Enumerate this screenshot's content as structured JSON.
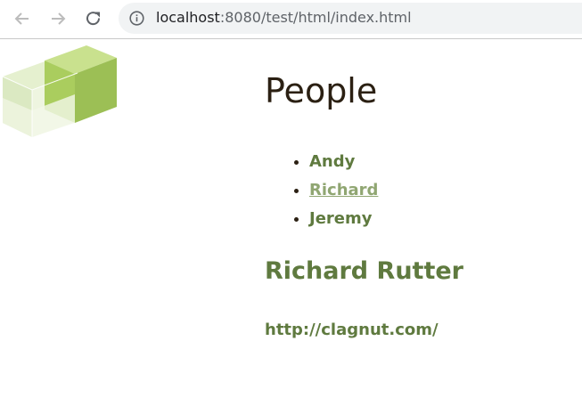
{
  "browser": {
    "url_host": "localhost",
    "url_rest": ":8080/test/html/index.html",
    "icons": {
      "back": "arrow-left-icon",
      "forward": "arrow-right-icon",
      "reload": "reload-icon",
      "info": "info-icon"
    }
  },
  "page": {
    "logo_icon": "green-cubes-logo",
    "title": "People",
    "people": [
      "Andy",
      "Richard",
      "Jeremy"
    ],
    "selected": {
      "name": "Richard Rutter",
      "url": "http://clagnut.com/"
    },
    "colors": {
      "title": "#2b2013",
      "accent": "#5f7a3f",
      "link": "#90a672"
    }
  }
}
